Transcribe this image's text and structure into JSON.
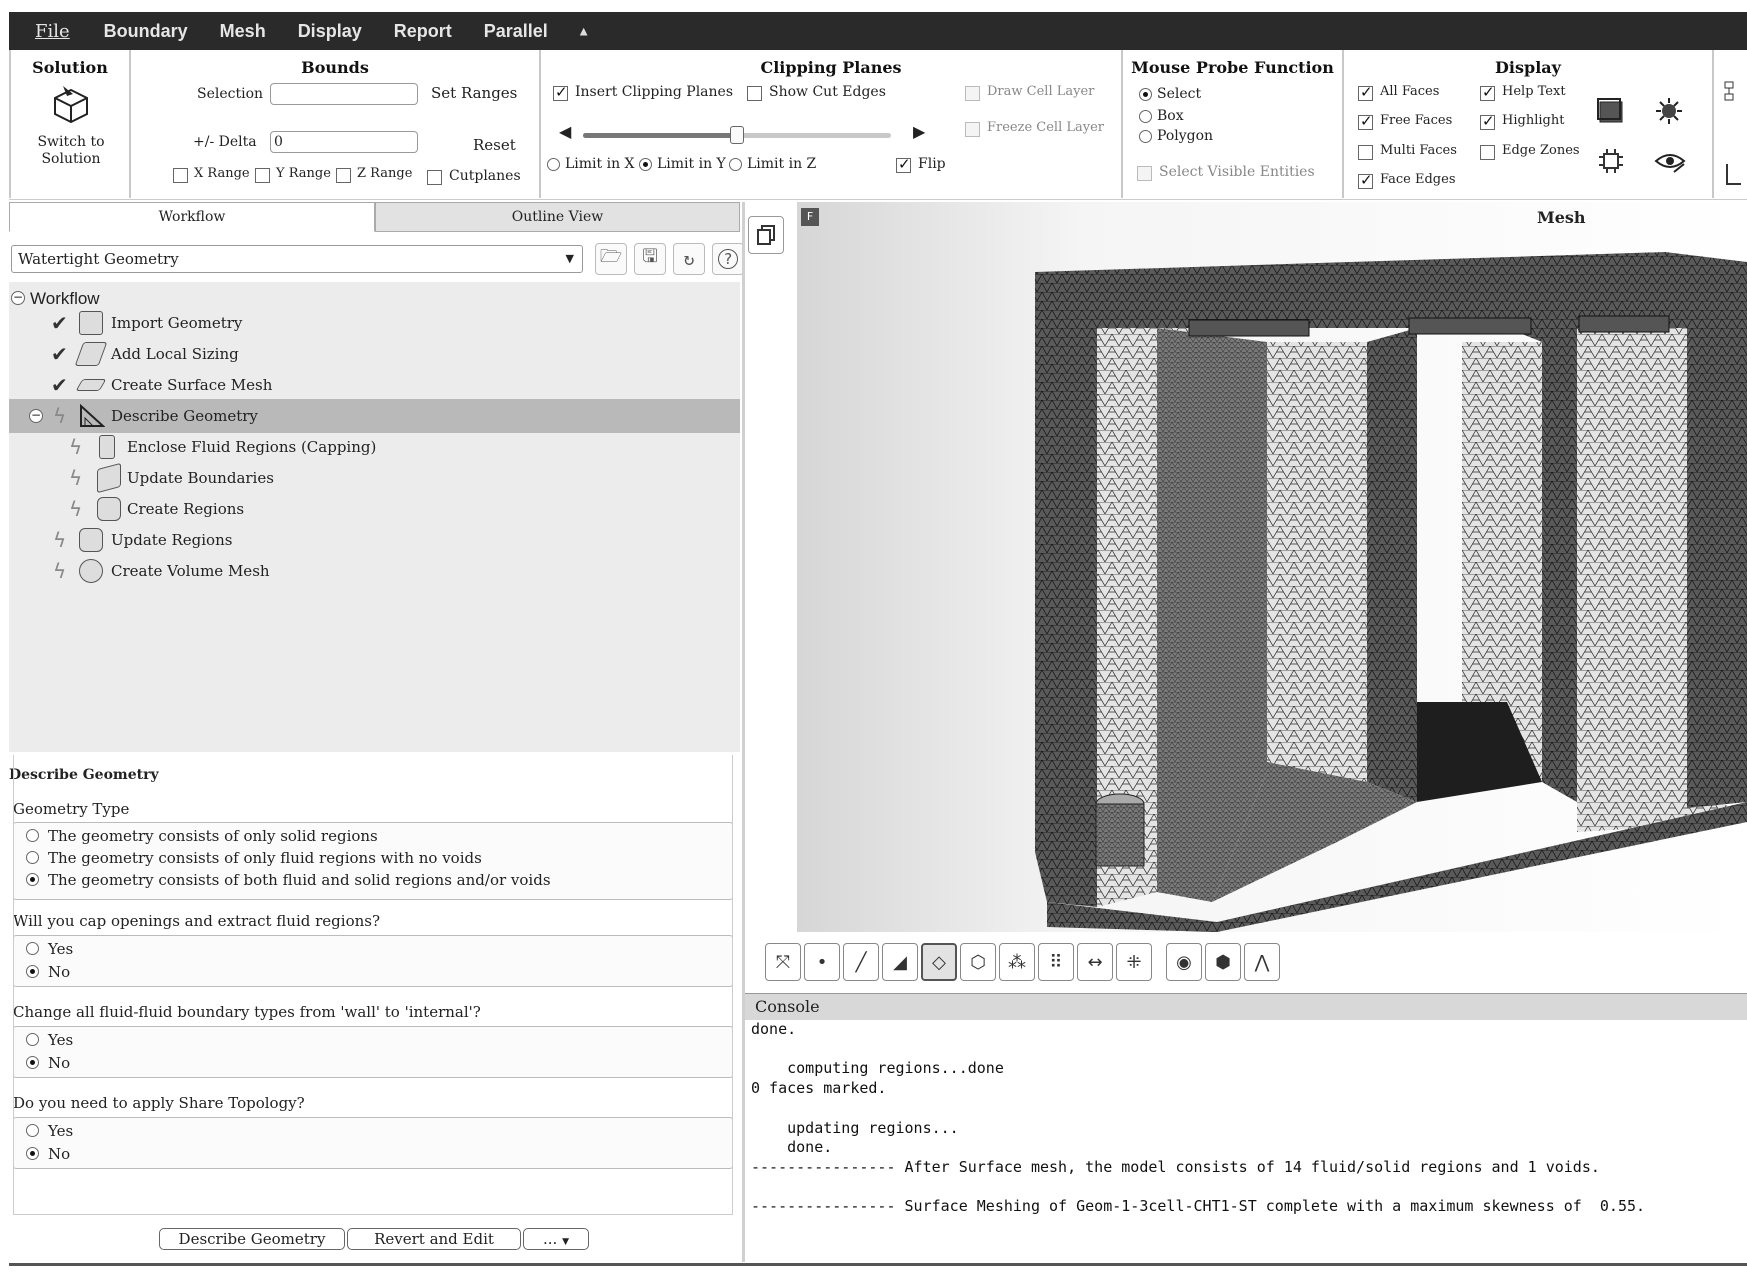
{
  "menu": {
    "items": [
      "File",
      "Boundary",
      "Mesh",
      "Display",
      "Report",
      "Parallel"
    ]
  },
  "ribbon": {
    "solution": {
      "title": "Solution",
      "switch_label_1": "Switch to",
      "switch_label_2": "Solution"
    },
    "bounds": {
      "title": "Bounds",
      "selection_label": "Selection",
      "selection_value": "",
      "set_ranges": "Set Ranges",
      "delta_label": "+/- Delta",
      "delta_value": "0",
      "reset": "Reset",
      "x_range": "X Range",
      "y_range": "Y Range",
      "z_range": "Z Range",
      "cutplanes": "Cutplanes"
    },
    "clipping": {
      "title": "Clipping Planes",
      "insert": "Insert Clipping Planes",
      "show_cut_edges": "Show Cut Edges",
      "draw_cell_layer": "Draw Cell Layer",
      "freeze_cell_layer": "Freeze Cell Layer",
      "slider_fraction": 0.5,
      "limit_x": "Limit in X",
      "limit_y": "Limit in Y",
      "limit_z": "Limit in Z",
      "flip": "Flip"
    },
    "probe": {
      "title": "Mouse Probe Function",
      "select": "Select",
      "box": "Box",
      "polygon": "Polygon",
      "visible": "Select Visible Entities"
    },
    "display": {
      "title": "Display",
      "all_faces": "All Faces",
      "free_faces": "Free Faces",
      "multi_faces": "Multi Faces",
      "face_edges": "Face Edges",
      "help_text": "Help Text",
      "highlight": "Highlight",
      "edge_zones": "Edge Zones"
    }
  },
  "left": {
    "tabs": [
      "Workflow",
      "Outline View"
    ],
    "workflow_select": "Watertight Geometry",
    "tree_root": "Workflow",
    "tree": [
      {
        "label": "Import Geometry",
        "state": "done"
      },
      {
        "label": "Add Local Sizing",
        "state": "done"
      },
      {
        "label": "Create Surface Mesh",
        "state": "done"
      },
      {
        "label": "Describe Geometry",
        "state": "pending"
      },
      {
        "label": "Enclose Fluid Regions (Capping)",
        "state": "pending"
      },
      {
        "label": "Update Boundaries",
        "state": "pending"
      },
      {
        "label": "Create Regions",
        "state": "pending"
      },
      {
        "label": "Update Regions",
        "state": "pending"
      },
      {
        "label": "Create Volume Mesh",
        "state": "pending"
      }
    ],
    "describe": {
      "title": "Describe Geometry",
      "geometry_type_label": "Geometry Type",
      "geom_options": [
        "The geometry consists of only solid regions",
        "The geometry consists of only fluid regions with no voids",
        "The geometry consists of both fluid and solid regions and/or voids"
      ],
      "q_cap": "Will you cap openings and extract fluid regions?",
      "q_change": "Change all fluid-fluid boundary types from 'wall' to 'internal'?",
      "q_share": "Do you need to apply Share Topology?",
      "yes": "Yes",
      "no": "No",
      "btn_describe": "Describe Geometry",
      "btn_revert": "Revert and Edit",
      "btn_more": "..."
    }
  },
  "graphics": {
    "title": "Mesh",
    "badge": "F"
  },
  "console": {
    "title": "Console",
    "text": "done.\n\n    computing regions...done\n0 faces marked.\n\n    updating regions...\n    done.\n---------------- After Surface mesh, the model consists of 14 fluid/solid regions and 1 voids.\n\n---------------- Surface Meshing of Geom-1-3cell-CHT1-ST complete with a maximum skewness of  0.55."
  },
  "colors": {
    "menubar": "#2a2a2a",
    "tree_bg": "#ececec",
    "selected_row": "#b9b9b9"
  }
}
